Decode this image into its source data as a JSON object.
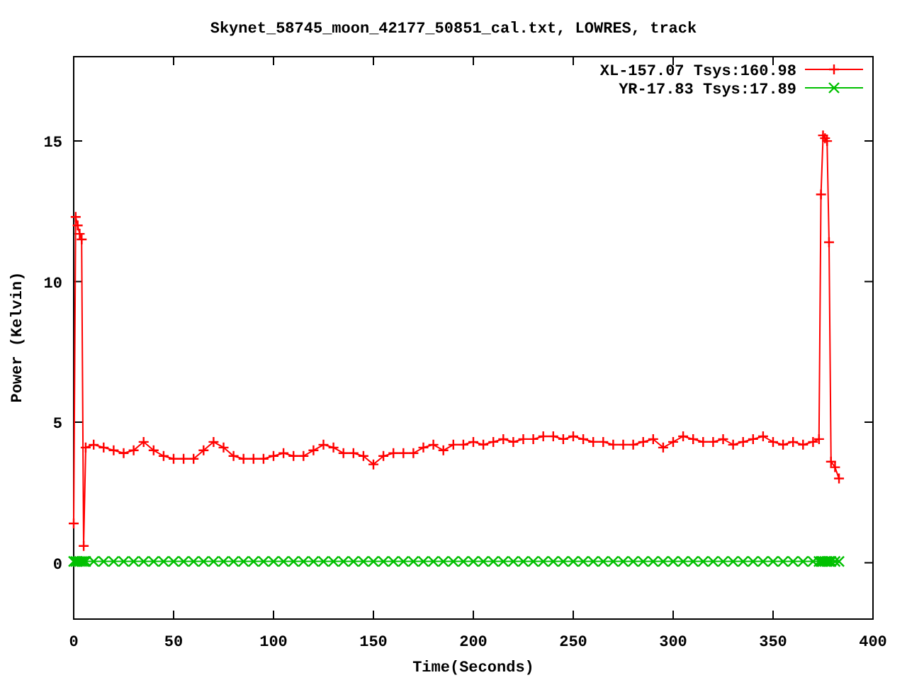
{
  "chart_data": {
    "type": "line",
    "title": "Skynet_58745_moon_42177_50851_cal.txt, LOWRES, track",
    "xlabel": "Time(Seconds)",
    "ylabel": "Power (Kelvin)",
    "legend": true,
    "xlim": [
      0,
      400
    ],
    "ylim": [
      -2,
      18
    ],
    "xticks": [
      0,
      50,
      100,
      150,
      200,
      250,
      300,
      350,
      400
    ],
    "yticks": [
      0,
      5,
      10,
      15
    ],
    "x": [
      0,
      1,
      2,
      3,
      4,
      5,
      6,
      10,
      15,
      20,
      25,
      30,
      35,
      40,
      45,
      50,
      55,
      60,
      65,
      70,
      75,
      80,
      85,
      90,
      95,
      100,
      105,
      110,
      115,
      120,
      125,
      130,
      135,
      140,
      145,
      150,
      155,
      160,
      165,
      170,
      175,
      180,
      185,
      190,
      195,
      200,
      205,
      210,
      215,
      220,
      225,
      230,
      235,
      240,
      245,
      250,
      255,
      260,
      265,
      270,
      275,
      280,
      285,
      290,
      295,
      300,
      305,
      310,
      315,
      320,
      325,
      330,
      335,
      340,
      345,
      350,
      355,
      360,
      365,
      370,
      373,
      374,
      375,
      376,
      377,
      378,
      379,
      381,
      383
    ],
    "series": [
      {
        "name": "XL-157.07 Tsys:160.98",
        "color": "#ff0000",
        "marker": "plus",
        "values": [
          1.4,
          12.3,
          12.0,
          11.7,
          11.5,
          0.6,
          4.1,
          4.2,
          4.1,
          4.0,
          3.9,
          4.0,
          4.3,
          4.0,
          3.8,
          3.7,
          3.7,
          3.7,
          4.0,
          4.3,
          4.1,
          3.8,
          3.7,
          3.7,
          3.7,
          3.8,
          3.9,
          3.8,
          3.8,
          4.0,
          4.2,
          4.1,
          3.9,
          3.9,
          3.8,
          3.5,
          3.8,
          3.9,
          3.9,
          3.9,
          4.1,
          4.2,
          4.0,
          4.2,
          4.2,
          4.3,
          4.2,
          4.3,
          4.4,
          4.3,
          4.4,
          4.4,
          4.5,
          4.5,
          4.4,
          4.5,
          4.4,
          4.3,
          4.3,
          4.2,
          4.2,
          4.2,
          4.3,
          4.4,
          4.1,
          4.3,
          4.5,
          4.4,
          4.3,
          4.3,
          4.4,
          4.2,
          4.3,
          4.4,
          4.5,
          4.3,
          4.2,
          4.3,
          4.2,
          4.3,
          4.4,
          13.1,
          15.2,
          15.1,
          15.0,
          11.4,
          3.6,
          3.4,
          3.0
        ]
      },
      {
        "name": "YR-17.83 Tsys:17.89",
        "color": "#00c000",
        "marker": "cross",
        "values": [
          0.05,
          0.05,
          0.05,
          0.05,
          0.05,
          0.05,
          0.05,
          0.05,
          0.05,
          0.05,
          0.05,
          0.05,
          0.05,
          0.05,
          0.05,
          0.05,
          0.05,
          0.05,
          0.05,
          0.05,
          0.05,
          0.05,
          0.05,
          0.05,
          0.05,
          0.05,
          0.05,
          0.05,
          0.05,
          0.05,
          0.05,
          0.05,
          0.05,
          0.05,
          0.05,
          0.05,
          0.05,
          0.05,
          0.05,
          0.05,
          0.05,
          0.05,
          0.05,
          0.05,
          0.05,
          0.05,
          0.05,
          0.05,
          0.05,
          0.05,
          0.05,
          0.05,
          0.05,
          0.05,
          0.05,
          0.05,
          0.05,
          0.05,
          0.05,
          0.05,
          0.05,
          0.05,
          0.05,
          0.05,
          0.05,
          0.05,
          0.05,
          0.05,
          0.05,
          0.05,
          0.05,
          0.05,
          0.05,
          0.05,
          0.05,
          0.05,
          0.05,
          0.05,
          0.05,
          0.05,
          0.05,
          0.05,
          0.05,
          0.05,
          0.05,
          0.05,
          0.05,
          0.05,
          0.05
        ]
      }
    ]
  }
}
